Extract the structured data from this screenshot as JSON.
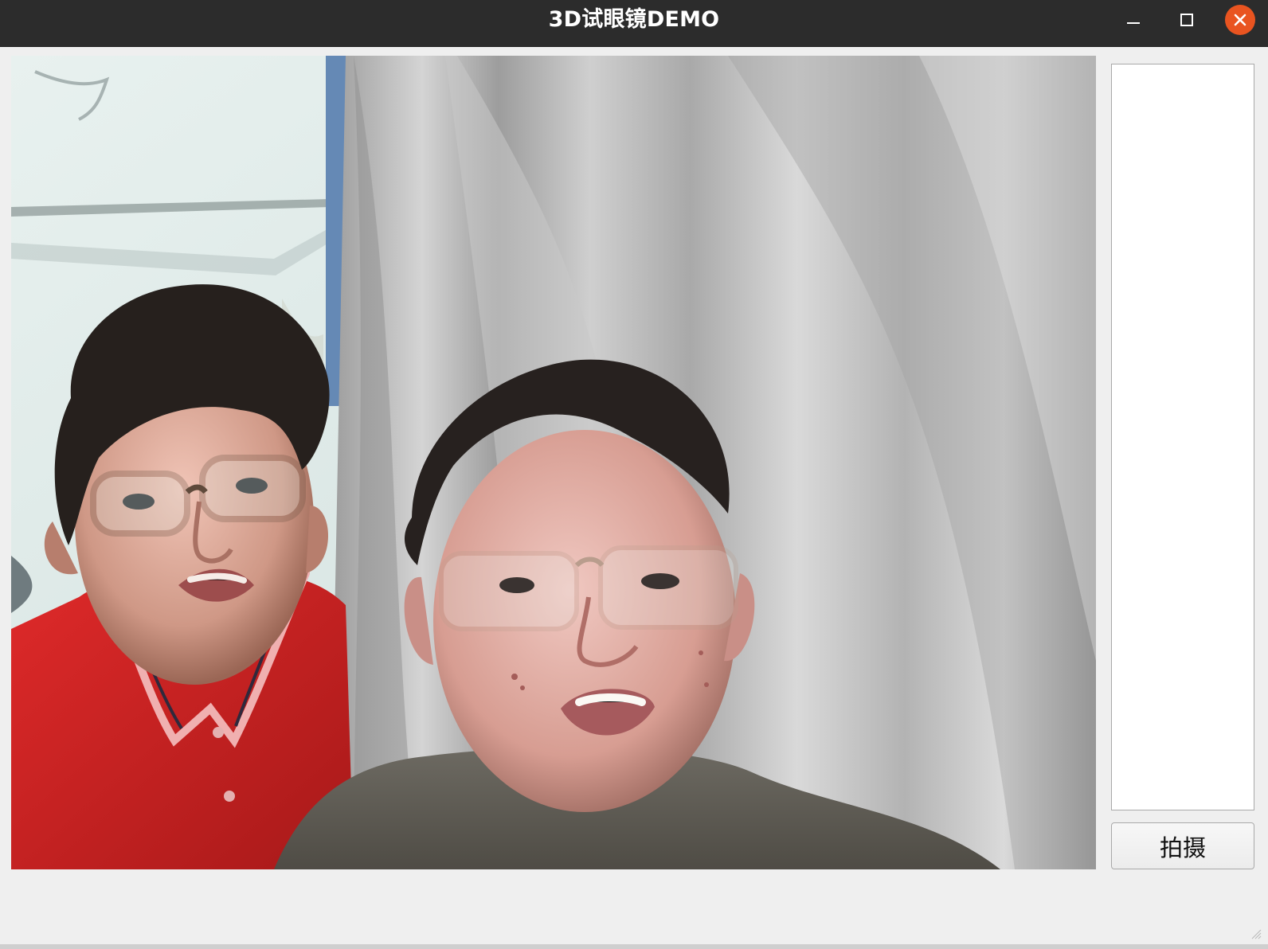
{
  "window": {
    "title": "3D试眼镜DEMO"
  },
  "window_controls": {
    "minimize_icon": "minimize-icon",
    "maximize_icon": "maximize-icon",
    "close_icon": "close-icon",
    "close_color": "#e95420"
  },
  "camera": {
    "feed": "camera-preview-image"
  },
  "side_panel": {
    "capture_label": "拍摄"
  },
  "colors": {
    "titlebar": "#2c2c2c",
    "window_background": "#efefef",
    "panel_background": "#ffffff",
    "border": "#a9a9a9",
    "accent_orange": "#e95420"
  }
}
